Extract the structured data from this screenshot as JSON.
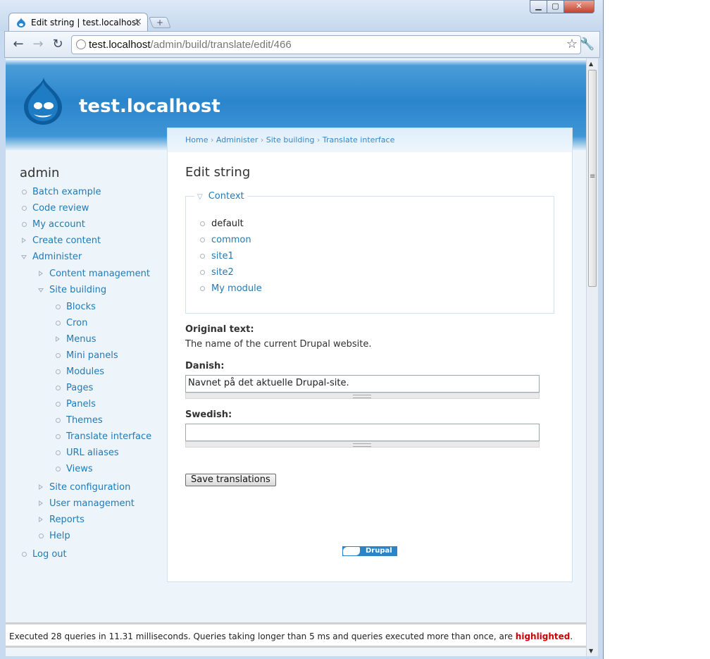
{
  "browser": {
    "tab_title": "Edit string | test.localhost",
    "tab_close": "×",
    "new_tab": "+",
    "window_minimize": "▁",
    "window_maximize": "▢",
    "window_close": "✕",
    "back": "←",
    "forward": "→",
    "reload": "↻",
    "url_host": "test.localhost",
    "url_path": "/admin/build/translate/edit/466",
    "star": "☆",
    "wrench": "🔧"
  },
  "site": {
    "name": "test.localhost"
  },
  "breadcrumb": {
    "home": "Home",
    "administer": "Administer",
    "site_building": "Site building",
    "translate_interface": "Translate interface",
    "separator": " › "
  },
  "sidebar": {
    "title": "admin",
    "items": [
      {
        "label": "Batch example"
      },
      {
        "label": "Code review"
      },
      {
        "label": "My account"
      },
      {
        "label": "Create content"
      },
      {
        "label": "Administer"
      },
      {
        "label": "Content management"
      },
      {
        "label": "Site building"
      },
      {
        "label": "Blocks"
      },
      {
        "label": "Cron"
      },
      {
        "label": "Menus"
      },
      {
        "label": "Mini panels"
      },
      {
        "label": "Modules"
      },
      {
        "label": "Pages"
      },
      {
        "label": "Panels"
      },
      {
        "label": "Themes"
      },
      {
        "label": "Translate interface"
      },
      {
        "label": "URL aliases"
      },
      {
        "label": "Views"
      },
      {
        "label": "Site configuration"
      },
      {
        "label": "User management"
      },
      {
        "label": "Reports"
      },
      {
        "label": "Help"
      },
      {
        "label": "Log out"
      }
    ]
  },
  "main": {
    "title": "Edit string",
    "context": {
      "legend": "Context",
      "items": [
        "default",
        "common",
        "site1",
        "site2",
        "My module"
      ]
    },
    "original_label": "Original text:",
    "original_text": "The name of the current Drupal website.",
    "danish_label": "Danish:",
    "danish_value": "Navnet på det aktuelle Drupal-site.",
    "swedish_label": "Swedish:",
    "swedish_value": "",
    "save_button": "Save translations",
    "powered_by": "Drupal"
  },
  "devel": {
    "footer_prefix": "Executed 28 queries in 11.31 milliseconds. Queries taking longer than 5 ms and queries executed more than once, are ",
    "footer_highlight": "highlighted",
    "footer_suffix": "."
  },
  "colors": {
    "link": "#1f7ab8",
    "header_blue": "#2b85cc",
    "highlight_red": "#cc0000"
  }
}
